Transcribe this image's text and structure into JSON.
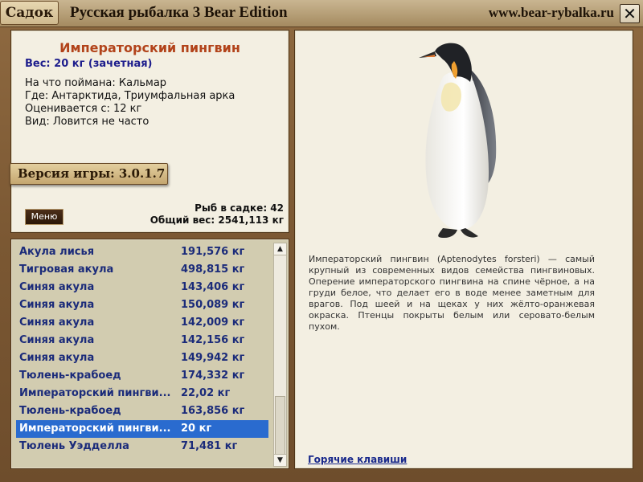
{
  "titlebar": {
    "tab_label": "Садок",
    "title": "Русская рыбалка 3 Bear Edition",
    "site": "www.bear-rybalka.ru",
    "close_icon": "close-icon"
  },
  "info": {
    "name": "Императорский пингвин",
    "weight": "Вес: 20 кг (зачетная)",
    "bait": "На что поймана: Кальмар",
    "place": "Где: Антарктида, Триумфальная арка",
    "value": "Оценивается с: 12 кг",
    "kind": "Вид: Ловится не часто",
    "version": "Версия игры: 3.0.1.7",
    "menu_label": "Меню",
    "fish_count": "Рыб в садке: 42",
    "total_weight": "Общий вес: 2541,113 кг"
  },
  "list": {
    "selected_index": 10,
    "rows": [
      {
        "name": "Акула лисья",
        "weight": "191,576 кг"
      },
      {
        "name": "Тигровая акула",
        "weight": "498,815 кг"
      },
      {
        "name": "Синяя акула",
        "weight": "143,406 кг"
      },
      {
        "name": "Синяя акула",
        "weight": "150,089 кг"
      },
      {
        "name": "Синяя акула",
        "weight": "142,009 кг"
      },
      {
        "name": "Синяя акула",
        "weight": "142,156 кг"
      },
      {
        "name": "Синяя акула",
        "weight": "149,942 кг"
      },
      {
        "name": "Тюлень-крабоед",
        "weight": "174,332 кг"
      },
      {
        "name": "Императорский пингви...",
        "weight": "22,02 кг"
      },
      {
        "name": "Тюлень-крабоед",
        "weight": "163,856 кг"
      },
      {
        "name": "Императорский пингви...",
        "weight": "20 кг"
      },
      {
        "name": "Тюлень Уэдделла",
        "weight": "71,481 кг"
      }
    ],
    "scroll_up_icon": "arrow-up-icon",
    "scroll_down_icon": "arrow-down-icon"
  },
  "detail": {
    "image": "emperor-penguin-image",
    "description": "Императорский пингвин (Aptenodytes forsteri) — самый крупный из современных видов семейства пингвиновых. Оперение императорского пингвина на спине чёрное, а на груди белое, что делает его в воде менее заметным для врагов. Под шеей и на щеках у них жёлто-оранжевая окраска. Птенцы покрыты белым или серовато-белым пухом.",
    "hotkeys_link": "Горячие клавиши"
  }
}
